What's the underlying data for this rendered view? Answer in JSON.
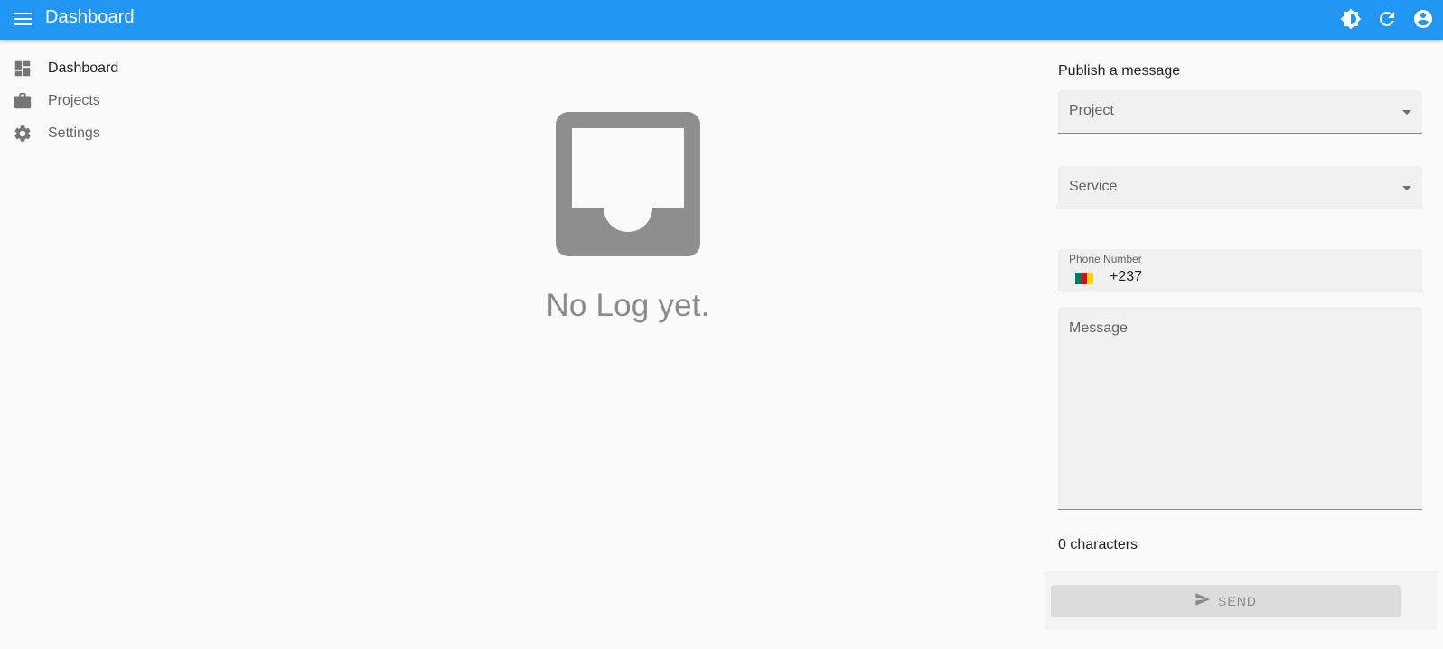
{
  "topbar": {
    "title": "Dashboard",
    "color": "#2196f3",
    "icons": [
      "menu-icon",
      "brightness-icon",
      "refresh-icon",
      "account-circle-icon"
    ]
  },
  "sidebar": {
    "items": [
      {
        "label": "Dashboard",
        "icon": "dashboard-icon",
        "active": true
      },
      {
        "label": "Projects",
        "icon": "briefcase-icon",
        "active": false
      },
      {
        "label": "Settings",
        "icon": "gear-icon",
        "active": false
      }
    ]
  },
  "empty_state": {
    "icon": "inbox-icon",
    "label": "No Log yet."
  },
  "publish": {
    "title": "Publish a message",
    "project_placeholder": "Project",
    "service_placeholder": "Service",
    "phone_label": "Phone Number",
    "phone_value": "+237",
    "phone_flag": "cameroon-flag-icon",
    "message_placeholder": "Message",
    "char_count": "0 characters",
    "send_label": "SEND",
    "send_icon": "send-icon"
  }
}
